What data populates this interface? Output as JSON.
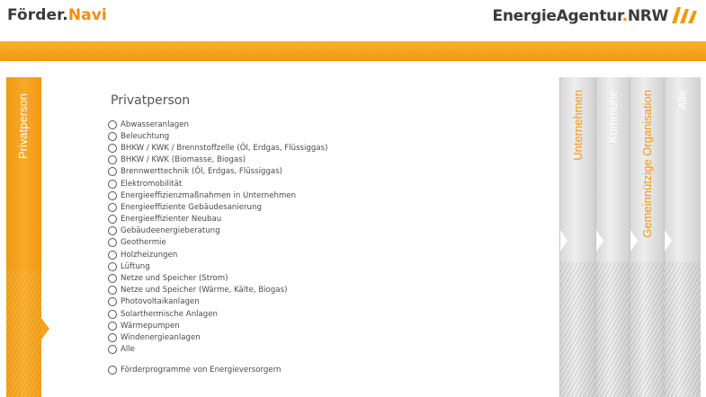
{
  "header": {
    "logo_left_part1": "Förder.",
    "logo_left_part2": "Navi",
    "logo_right_text": "EnergieAgentur",
    "logo_right_dot": ".",
    "logo_right_suffix": "NRW",
    "brand_color": "#f09a12"
  },
  "left_tab": {
    "label": "Privatperson"
  },
  "main": {
    "title": "Privatperson",
    "options": [
      "Abwasseranlagen",
      "Beleuchtung",
      "BHKW / KWK / Brennstoffzelle (Öl, Erdgas, Flüssiggas)",
      "BHKW / KWK (Biomasse, Biogas)",
      "Brennwerttechnik (Öl, Erdgas, Flüssiggas)",
      "Elektromobilität",
      "Energieeffizienzmaßnahmen in Unternehmen",
      "Energieeffiziente Gebäudesanierung",
      "Energieeffizienter Neubau",
      "Gebäudeenergieberatung",
      "Geothermie",
      "Holzheizungen",
      "Lüftung",
      "Netze und Speicher (Strom)",
      "Netze und Speicher (Wärme, Kälte, Biogas)",
      "Photovoltaikanlagen",
      "Solarthermische Anlagen",
      "Wärmepumpen",
      "Windenergieanlagen",
      "Alle"
    ],
    "extra_option": "Förderprogramme von Energieversorgern"
  },
  "right_tabs": [
    "Unternehmen",
    "Kommune",
    "Gemeinnützige Organisation",
    "Alle"
  ]
}
